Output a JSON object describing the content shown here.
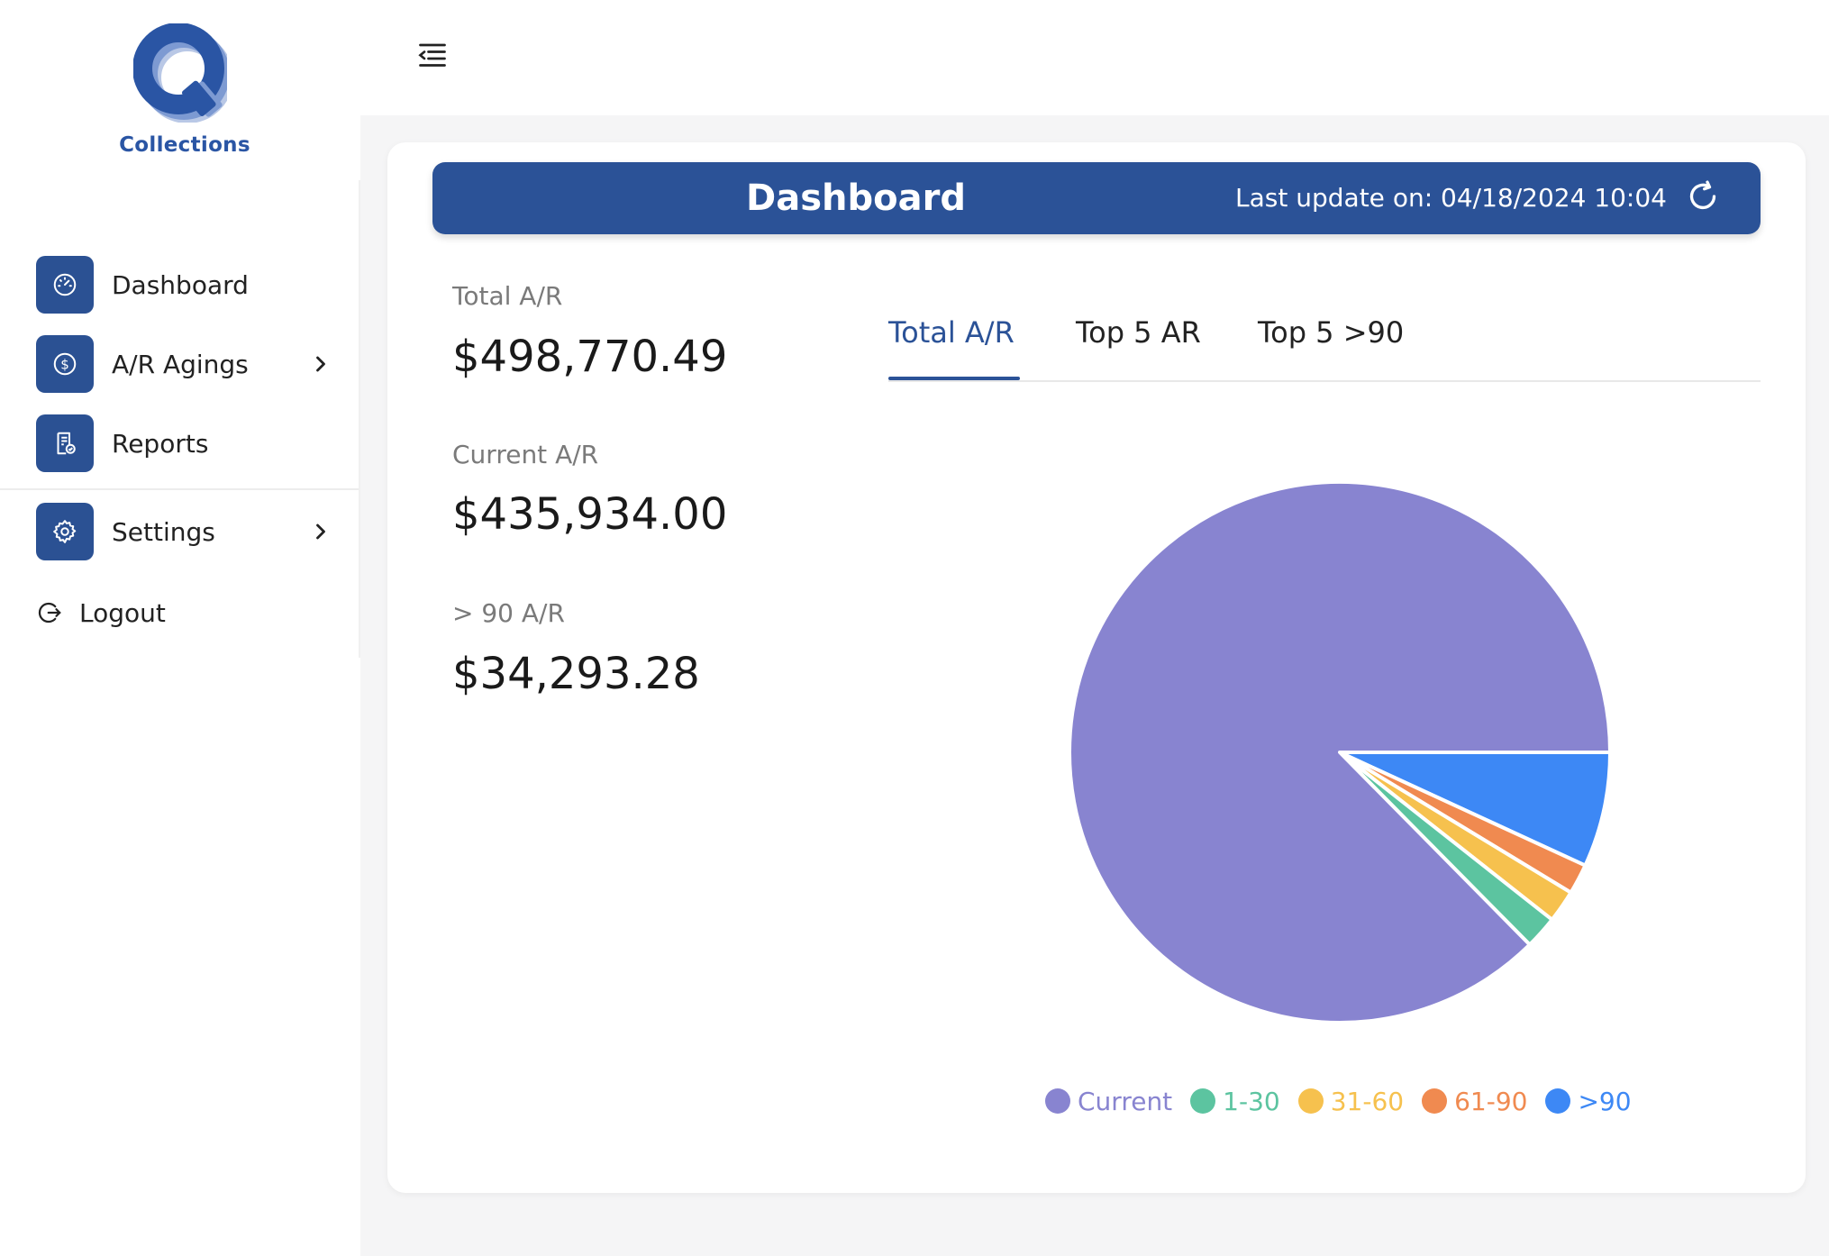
{
  "brand": {
    "name": "Collections",
    "letter": "Q",
    "color": "#2a55a4"
  },
  "sidebar": {
    "items": [
      {
        "label": "Dashboard",
        "icon": "speedometer-icon",
        "has_submenu": false
      },
      {
        "label": "A/R Agings",
        "icon": "dollar-circle-icon",
        "has_submenu": true
      },
      {
        "label": "Reports",
        "icon": "report-check-icon",
        "has_submenu": false
      },
      {
        "label": "Settings",
        "icon": "gear-icon",
        "has_submenu": true
      }
    ],
    "logout_label": "Logout"
  },
  "header": {
    "title": "Dashboard",
    "last_update": "Last update on: 04/18/2024 10:04",
    "accent": "#2b5297"
  },
  "stats": {
    "total_label": "Total A/R",
    "total_value": "$498,770.49",
    "current_label": "Current A/R",
    "current_value": "$435,934.00",
    "over90_label": "> 90 A/R",
    "over90_value": "$34,293.28"
  },
  "tabs": [
    {
      "label": "Total A/R",
      "active": true
    },
    {
      "label": "Top 5 AR",
      "active": false
    },
    {
      "label": "Top 5 >90",
      "active": false
    }
  ],
  "chart_data": {
    "type": "pie",
    "categories": [
      "Current",
      "1-30",
      "31-60",
      "61-90",
      ">90"
    ],
    "values": [
      435934.0,
      9850,
      9700,
      9000,
      34293.28
    ],
    "colors": [
      "#8884d0",
      "#5cc4a0",
      "#f6c14e",
      "#f08a50",
      "#3d88f5"
    ],
    "legend_position": "bottom",
    "start_angle_deg": 0
  }
}
